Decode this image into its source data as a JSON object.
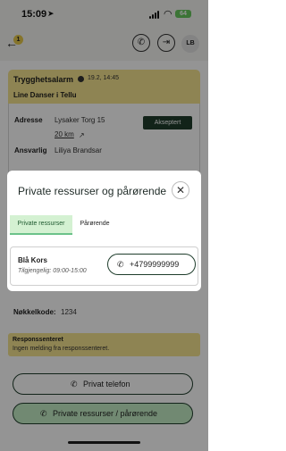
{
  "status_bar": {
    "time": "15:09",
    "location_icon": "navigation-arrow-icon",
    "battery": "64"
  },
  "app_bar": {
    "notification_count": "1",
    "back_icon": "back-arrow-icon",
    "phone_icon": "phone-icon",
    "logout_icon": "logout-icon",
    "avatar_initials": "LB"
  },
  "alarm": {
    "title": "Trygghetsalarm",
    "time": "19.2, 14:45",
    "person": "Line Danser i Tellu",
    "address_label": "Adresse",
    "address": "Lysaker Torg 15",
    "distance": "20 km",
    "responsible_label": "Ansvarlig",
    "responsible": "Liliya Brandsar",
    "accept_button": "Akseptert"
  },
  "key_code": {
    "label": "Nøkkelkode:",
    "value": "1234"
  },
  "response_center": {
    "title": "Responssenteret",
    "text": "Ingen melding fra responssenteret."
  },
  "actions": {
    "private_phone": "Privat telefon",
    "private_resources": "Private ressurser / pårørende"
  },
  "modal": {
    "title": "Private ressurser og pårørende",
    "tabs": [
      {
        "label": "Private ressurser",
        "active": true
      },
      {
        "label": "Pårørende",
        "active": false
      }
    ],
    "contact": {
      "name": "Blå Kors",
      "availability": "Tilgjengelig: 09:00-15:00",
      "phone": "+4799999999"
    }
  },
  "colors": {
    "accent_dark_green": "#1f3d2c",
    "alarm_yellow": "#f5e48f",
    "tab_active_bg": "#d4f1d2",
    "button_green": "#c3ecc5"
  }
}
